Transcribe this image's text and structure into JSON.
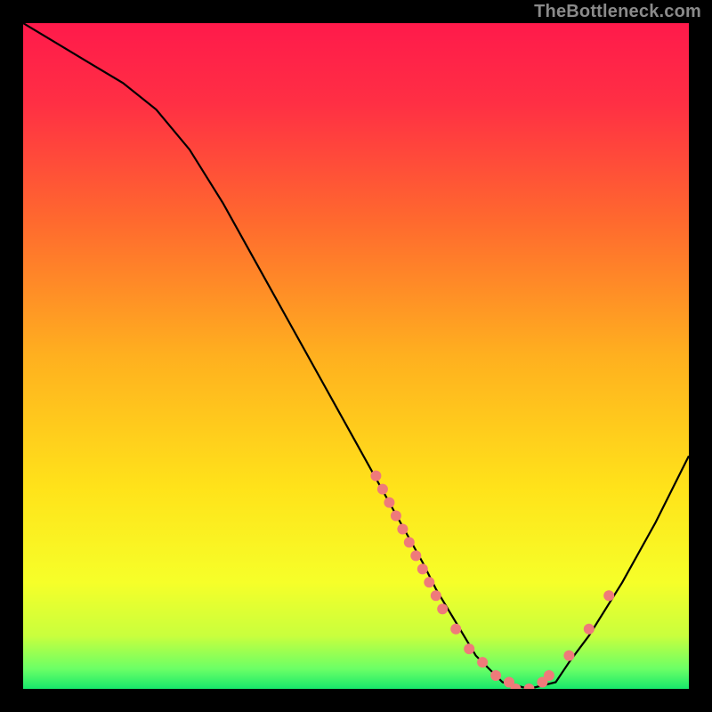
{
  "watermark": "TheBottleneck.com",
  "chart_data": {
    "type": "line",
    "title": "",
    "xlabel": "",
    "ylabel": "",
    "xlim": [
      0,
      100
    ],
    "ylim": [
      0,
      100
    ],
    "grid": false,
    "series": [
      {
        "name": "curve",
        "x": [
          0,
          5,
          10,
          15,
          20,
          25,
          30,
          35,
          40,
          45,
          50,
          55,
          60,
          62,
          65,
          68,
          72,
          76,
          80,
          82,
          85,
          90,
          95,
          100
        ],
        "y": [
          100,
          97,
          94,
          91,
          87,
          81,
          73,
          64,
          55,
          46,
          37,
          28,
          19,
          15,
          10,
          5,
          1,
          0,
          1,
          4,
          8,
          16,
          25,
          35
        ]
      }
    ],
    "points": {
      "name": "markers",
      "x": [
        53,
        54,
        55,
        56,
        57,
        58,
        59,
        60,
        61,
        62,
        63,
        65,
        67,
        69,
        71,
        73,
        74,
        76,
        78,
        79,
        82,
        85,
        88
      ],
      "y": [
        32,
        30,
        28,
        26,
        24,
        22,
        20,
        18,
        16,
        14,
        12,
        9,
        6,
        4,
        2,
        1,
        0,
        0,
        1,
        2,
        5,
        9,
        14
      ]
    },
    "gradient_stops": [
      {
        "offset": 0.0,
        "color": "#ff1a4b"
      },
      {
        "offset": 0.12,
        "color": "#ff2f44"
      },
      {
        "offset": 0.3,
        "color": "#ff6a2e"
      },
      {
        "offset": 0.5,
        "color": "#ffb01f"
      },
      {
        "offset": 0.7,
        "color": "#ffe31a"
      },
      {
        "offset": 0.84,
        "color": "#f6ff29"
      },
      {
        "offset": 0.92,
        "color": "#c9ff3d"
      },
      {
        "offset": 0.97,
        "color": "#6bff66"
      },
      {
        "offset": 1.0,
        "color": "#17e86b"
      }
    ],
    "marker_color": "#ef7a7a",
    "curve_color": "#000000"
  }
}
